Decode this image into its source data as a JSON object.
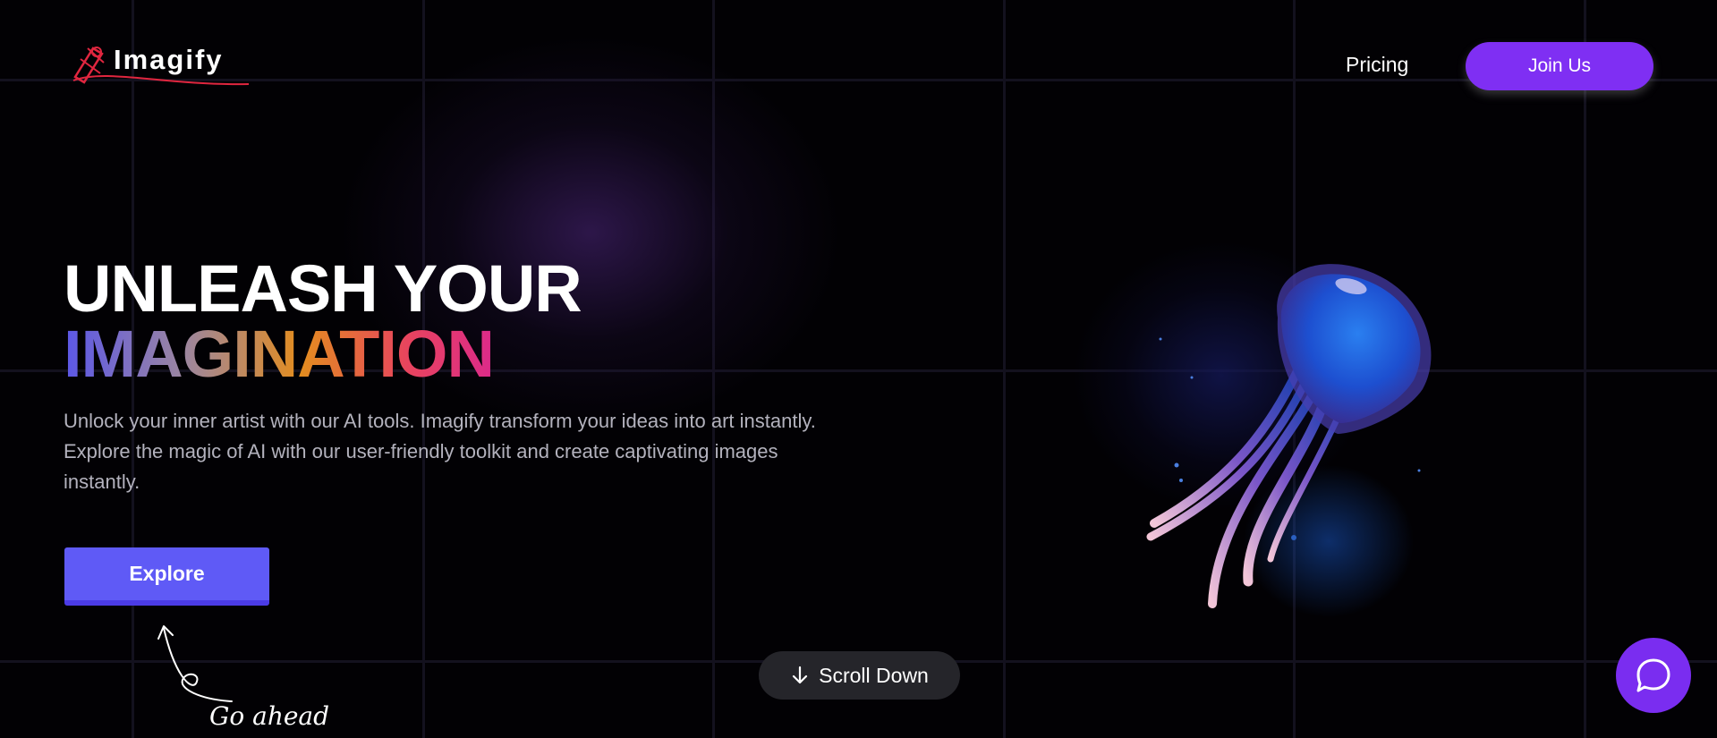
{
  "header": {
    "brand": "Imagify",
    "nav_pricing": "Pricing",
    "join_label": "Join Us"
  },
  "hero": {
    "title_line1": "UNLEASH YOUR",
    "title_line2": "IMAGINATION",
    "description": "Unlock your inner artist with our AI tools. Imagify transform your ideas into art instantly. Explore the magic of AI with our user-friendly toolkit and create captivating images instantly.",
    "explore_label": "Explore",
    "hint": "Go ahead",
    "scroll_label": "Scroll Down"
  },
  "icons": {
    "logo": "pen-nib-icon",
    "scroll": "arrow-down-icon",
    "chat": "chat-bubble-icon",
    "hint": "curved-arrow-icon"
  },
  "colors": {
    "background": "#020104",
    "accent_purple": "#7f2ff3",
    "explore_blue": "#5f5af6",
    "scroll_bg": "#25252a",
    "chat_purple": "#7a2df0",
    "gradient": [
      "#5b57e8",
      "#9c86a0",
      "#e38d1f",
      "#e8445e",
      "#dc2a8a"
    ]
  }
}
